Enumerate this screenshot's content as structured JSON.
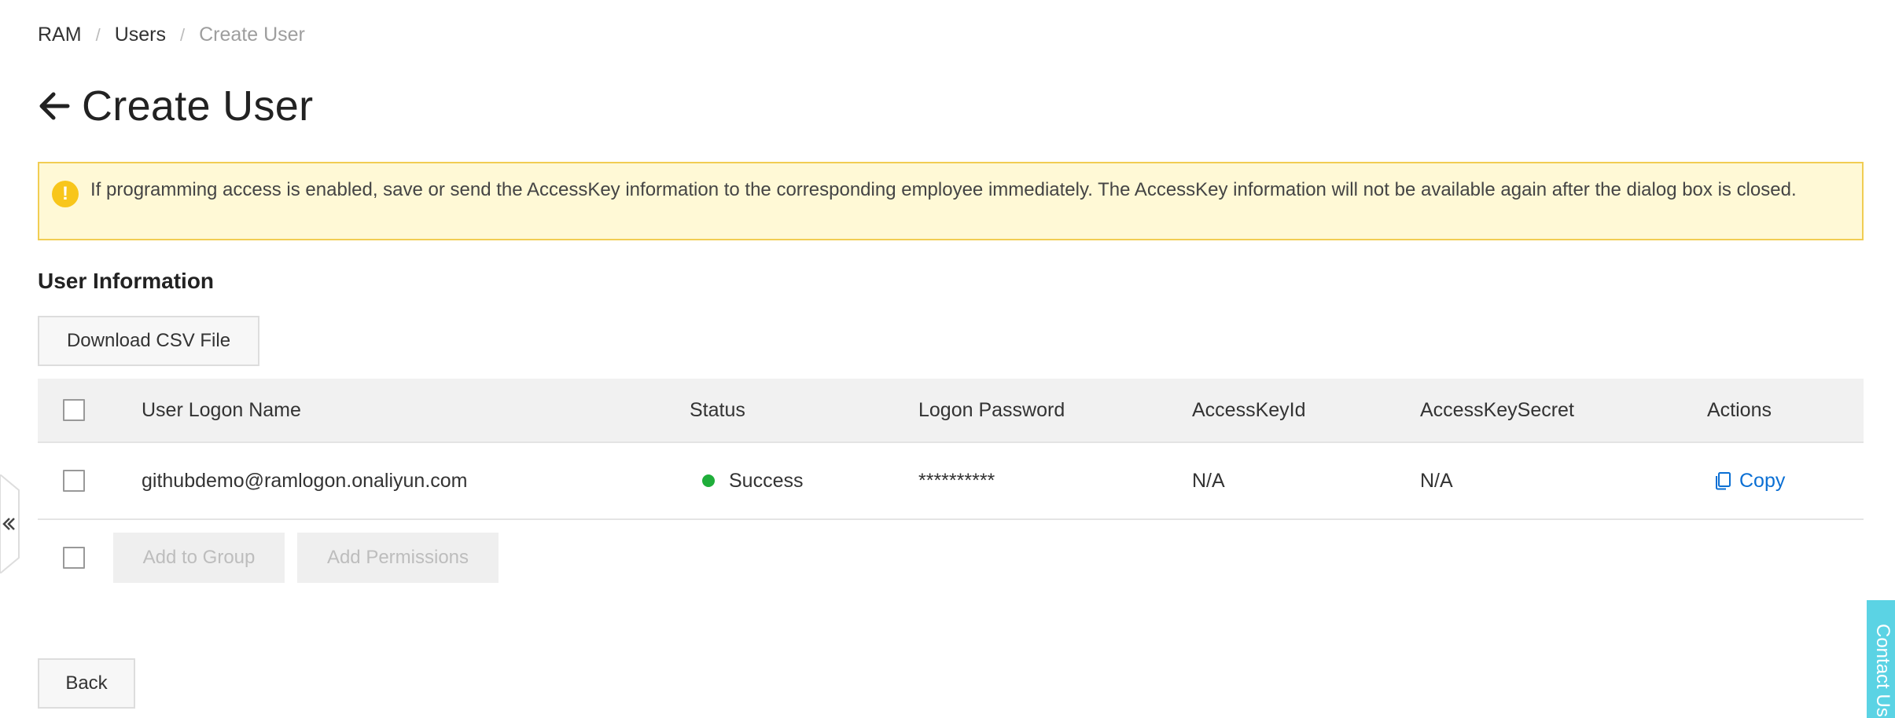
{
  "breadcrumb": {
    "items": [
      "RAM",
      "Users"
    ],
    "current": "Create User",
    "separator": "/"
  },
  "page": {
    "title": "Create User"
  },
  "alert": {
    "icon": "exclamation-icon",
    "text": "If programming access is enabled, save or send the AccessKey information to the corresponding employee immediately. The AccessKey information will not be available again after the dialog box is closed.",
    "color": "#fff9d6",
    "border_color": "#f1cd53"
  },
  "section": {
    "title": "User Information"
  },
  "toolbar": {
    "download_label": "Download CSV File"
  },
  "table": {
    "columns": [
      "User Logon Name",
      "Status",
      "Logon Password",
      "AccessKeyId",
      "AccessKeySecret",
      "Actions"
    ],
    "rows": [
      {
        "logon_name": "githubdemo@ramlogon.onaliyun.com",
        "status": "Success",
        "password": "**********",
        "access_key_id": "N/A",
        "access_key_secret": "N/A",
        "action": "Copy"
      }
    ]
  },
  "bulk_actions": {
    "add_group_label": "Add to Group",
    "add_permissions_label": "Add Permissions"
  },
  "footer": {
    "back_label": "Back"
  },
  "contact": {
    "label": "Contact Us"
  },
  "colors": {
    "success": "#1fae3a",
    "link": "#0a6fd4",
    "contact_tab": "#5bd3e4"
  }
}
